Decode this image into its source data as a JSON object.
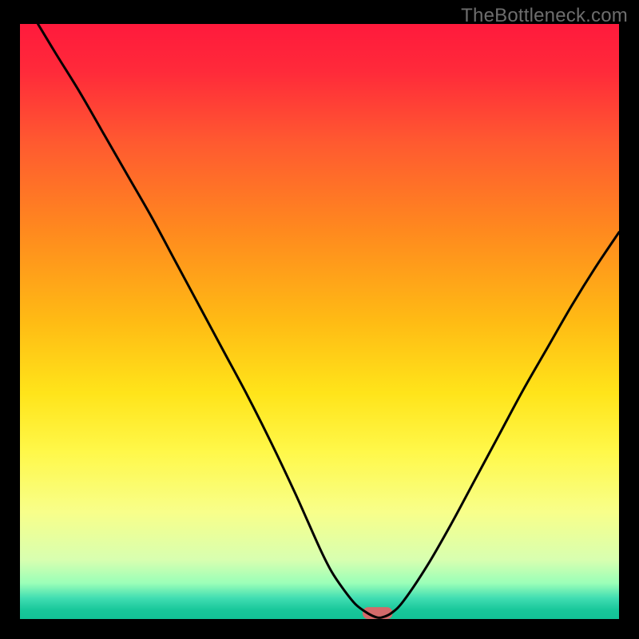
{
  "watermark": "TheBottleneck.com",
  "chart_data": {
    "type": "line",
    "title": "",
    "xlabel": "",
    "ylabel": "",
    "xlim": [
      0,
      100
    ],
    "ylim": [
      0,
      100
    ],
    "background_gradient": {
      "stops": [
        {
          "pos": 0.0,
          "color": "#ff1a3c"
        },
        {
          "pos": 0.08,
          "color": "#ff2a3a"
        },
        {
          "pos": 0.2,
          "color": "#ff5a30"
        },
        {
          "pos": 0.35,
          "color": "#ff8a1e"
        },
        {
          "pos": 0.5,
          "color": "#ffbb14"
        },
        {
          "pos": 0.62,
          "color": "#ffe41a"
        },
        {
          "pos": 0.72,
          "color": "#fff84a"
        },
        {
          "pos": 0.82,
          "color": "#f8ff8a"
        },
        {
          "pos": 0.9,
          "color": "#d8ffb0"
        },
        {
          "pos": 0.94,
          "color": "#9affb8"
        },
        {
          "pos": 0.965,
          "color": "#40ddb2"
        },
        {
          "pos": 0.985,
          "color": "#18c79a"
        },
        {
          "pos": 1.0,
          "color": "#12c296"
        }
      ]
    },
    "series": [
      {
        "name": "bottleneck-curve",
        "stroke": "#000000",
        "x": [
          3,
          6,
          10,
          14,
          18,
          22,
          26,
          30,
          34,
          38,
          42,
          46,
          50,
          52,
          54,
          56,
          58,
          59.5,
          60.5,
          62,
          64,
          68,
          72,
          76,
          80,
          84,
          88,
          92,
          96,
          100
        ],
        "y": [
          100,
          95,
          88.5,
          81.5,
          74.5,
          67.5,
          60,
          52.5,
          45,
          37.5,
          29.5,
          21,
          12,
          8,
          5,
          2.5,
          1,
          0.3,
          0.3,
          1,
          3,
          9,
          16,
          23.5,
          31,
          38.5,
          45.5,
          52.5,
          59,
          65
        ]
      }
    ],
    "marker": {
      "name": "target-region",
      "x_center": 59.7,
      "y": 0.0,
      "width": 5.0,
      "height": 2.0,
      "color": "#d46a6a"
    }
  }
}
